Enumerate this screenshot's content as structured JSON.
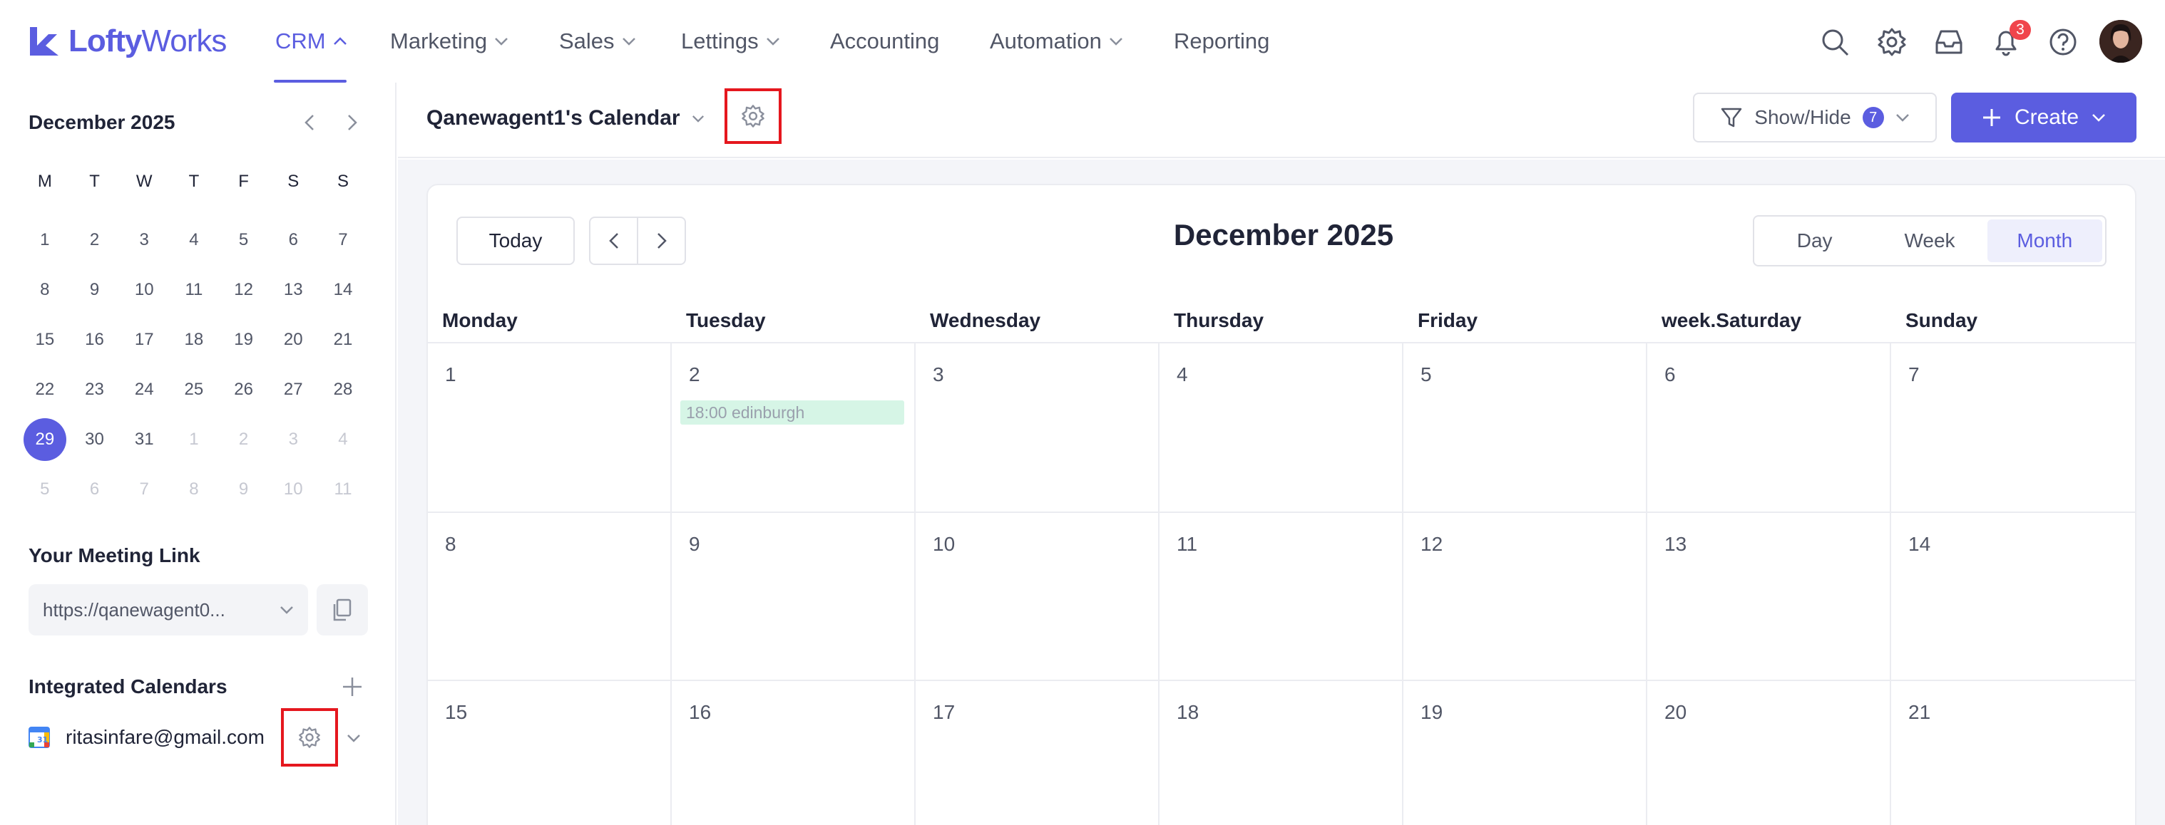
{
  "brand": {
    "part1": "Lofty",
    "part2": "Works"
  },
  "nav": [
    {
      "label": "CRM",
      "active": true,
      "dropdown": true
    },
    {
      "label": "Marketing",
      "dropdown": true
    },
    {
      "label": "Sales",
      "dropdown": true
    },
    {
      "label": "Lettings",
      "dropdown": true
    },
    {
      "label": "Accounting",
      "dropdown": false
    },
    {
      "label": "Automation",
      "dropdown": true
    },
    {
      "label": "Reporting",
      "dropdown": false
    }
  ],
  "notifications_count": "3",
  "colors": {
    "accent": "#5B5DE0",
    "highlight": "#E5171E",
    "event_bg": "#D6F5E6",
    "badge": "#F0454C"
  },
  "sidebar": {
    "mini_calendar": {
      "title": "December 2025",
      "weekdays": [
        "M",
        "T",
        "W",
        "T",
        "F",
        "S",
        "S"
      ],
      "weeks": [
        [
          "1",
          "2",
          "3",
          "4",
          "5",
          "6",
          "7"
        ],
        [
          "8",
          "9",
          "10",
          "11",
          "12",
          "13",
          "14"
        ],
        [
          "15",
          "16",
          "17",
          "18",
          "19",
          "20",
          "21"
        ],
        [
          "22",
          "23",
          "24",
          "25",
          "26",
          "27",
          "28"
        ],
        [
          "29",
          "30",
          "31",
          "1",
          "2",
          "3",
          "4"
        ],
        [
          "5",
          "6",
          "7",
          "8",
          "9",
          "10",
          "11"
        ]
      ],
      "selected": "29"
    },
    "meeting_link": {
      "title": "Your Meeting Link",
      "value": "https://qanewagent0..."
    },
    "integrated": {
      "title": "Integrated Calendars",
      "account": "ritasinfare@gmail.com"
    }
  },
  "header": {
    "calendar_name": "Qanewagent1's Calendar",
    "showhide_label": "Show/Hide",
    "showhide_count": "7",
    "create_label": "Create"
  },
  "calendar": {
    "today_label": "Today",
    "month_title": "December 2025",
    "views": [
      "Day",
      "Week",
      "Month"
    ],
    "active_view": "Month",
    "day_headers": [
      "Monday",
      "Tuesday",
      "Wednesday",
      "Thursday",
      "Friday",
      "week.Saturday",
      "Sunday"
    ],
    "weeks": [
      [
        "1",
        "2",
        "3",
        "4",
        "5",
        "6",
        "7"
      ],
      [
        "8",
        "9",
        "10",
        "11",
        "12",
        "13",
        "14"
      ],
      [
        "15",
        "16",
        "17",
        "18",
        "19",
        "20",
        "21"
      ]
    ],
    "events": [
      {
        "day": "2",
        "label": "18:00 edinburgh"
      }
    ]
  }
}
